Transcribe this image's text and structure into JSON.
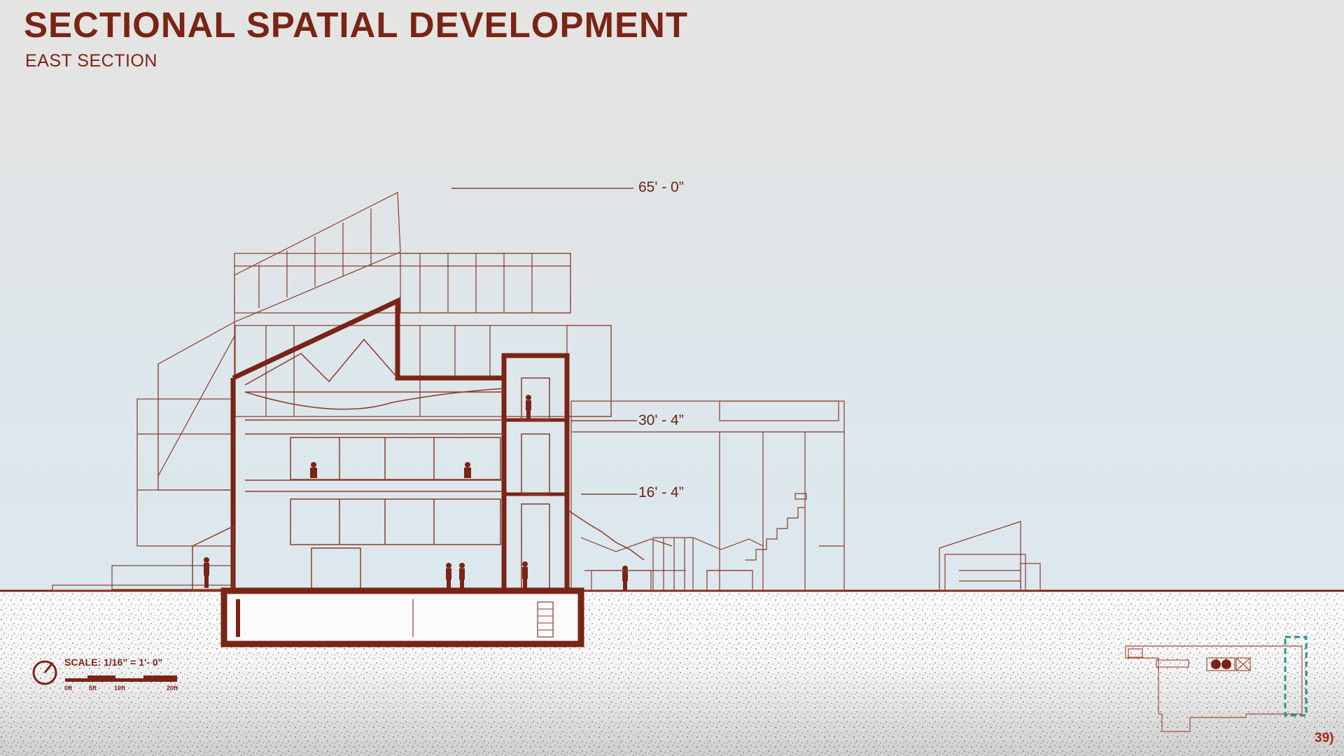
{
  "header": {
    "title": "SECTIONAL SPATIAL DEVELOPMENT",
    "subtitle": "EAST SECTION"
  },
  "levels": [
    {
      "label": "65' - 0”"
    },
    {
      "label": "30' - 4”"
    },
    {
      "label": "16' - 4”"
    }
  ],
  "scale": {
    "label": "SCALE: 1/16” = 1'- 0\"",
    "ticks": [
      "0ft",
      "5ft",
      "10ft",
      "20ft"
    ]
  },
  "page_number": "39)",
  "colors": {
    "section_cut": "#7a2416",
    "linework": "#8c3a2a",
    "key_plan_highlight": "#2f8f8f"
  },
  "icons": [
    "north-arrow-icon",
    "key-plan-icon"
  ]
}
